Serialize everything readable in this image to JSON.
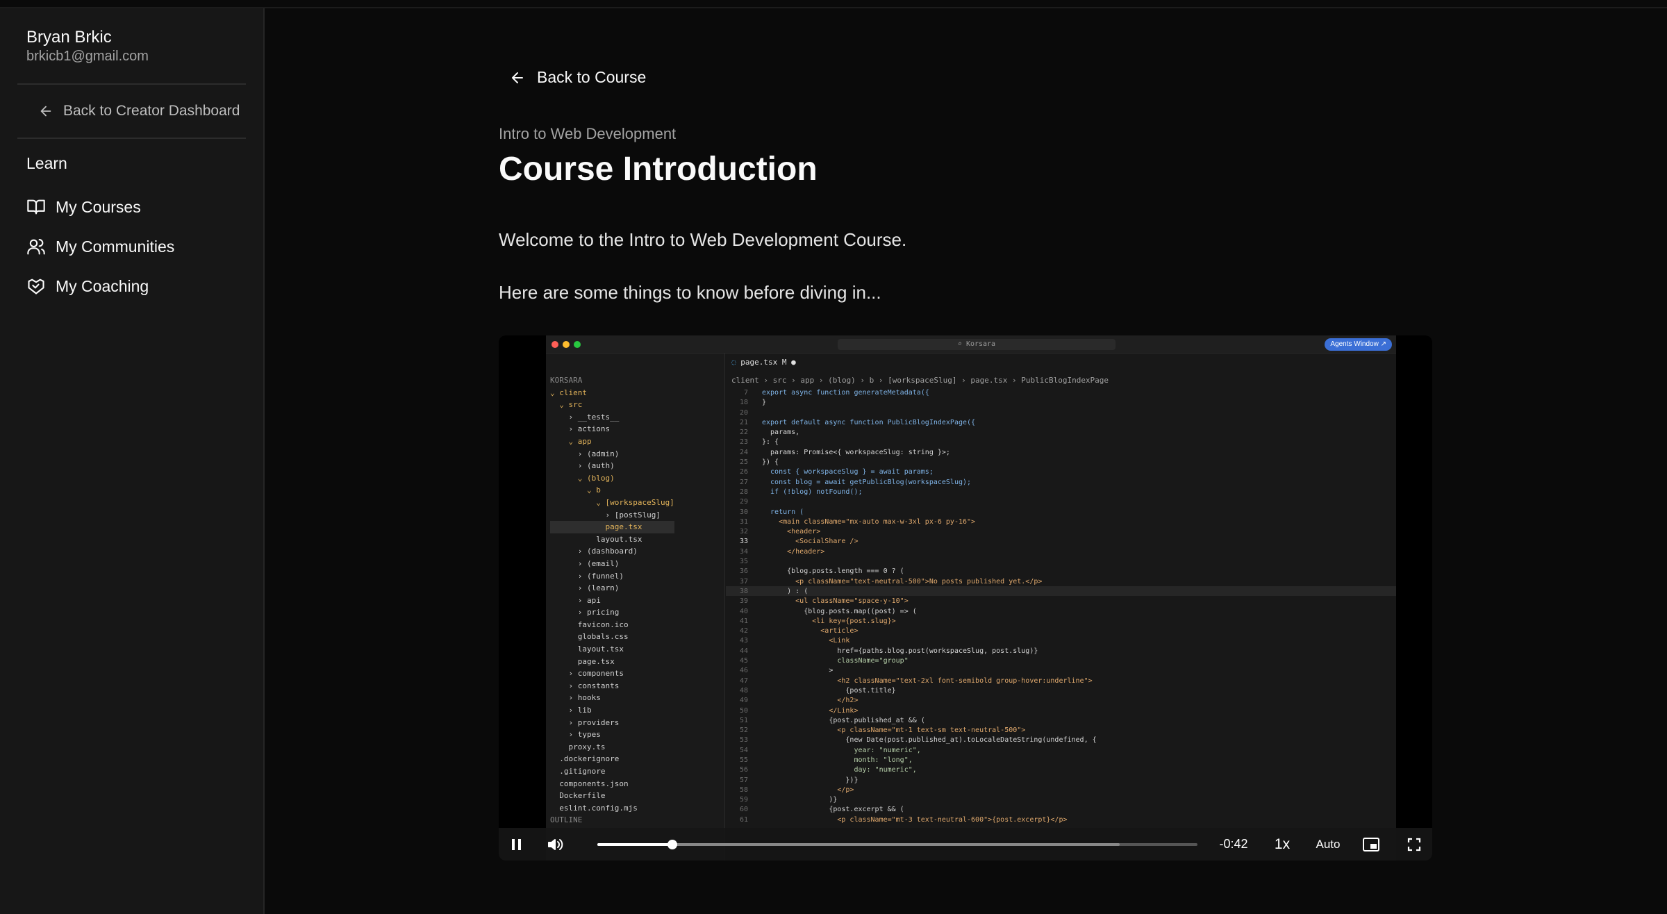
{
  "sidebar": {
    "user_name": "Bryan Brkic",
    "user_email": "brkicb1@gmail.com",
    "back_link": "Back to Creator Dashboard",
    "section_title": "Learn",
    "items": [
      {
        "label": "My Courses",
        "icon": "book-open-icon"
      },
      {
        "label": "My Communities",
        "icon": "users-icon"
      },
      {
        "label": "My Coaching",
        "icon": "handshake-icon"
      }
    ]
  },
  "main": {
    "back_link": "Back to Course",
    "course_name": "Intro to Web Development",
    "title": "Course Introduction",
    "paragraphs": [
      "Welcome to the Intro to Web Development Course.",
      "Here are some things to know before diving in..."
    ]
  },
  "video": {
    "time_remaining": "-0:42",
    "speed": "1x",
    "quality": "Auto",
    "progress": 0.125,
    "buffered": 0.87,
    "editor": {
      "search": "Korsara",
      "agents_button": "Agents Window ↗",
      "tab_label": "page.tsx  M",
      "breadcrumb": "client › src › app › (blog) › b › [workspaceSlug] › page.tsx › PublicBlogIndexPage",
      "tree": [
        "KORSARA",
        "⌄ client",
        "  ⌄ src",
        "    › __tests__",
        "    › actions",
        "    ⌄ app",
        "      › (admin)",
        "      › (auth)",
        "      ⌄ (blog)",
        "        ⌄ b",
        "          ⌄ [workspaceSlug]",
        "            › [postSlug]",
        "            page.tsx",
        "          layout.tsx",
        "      › (dashboard)",
        "      › (email)",
        "      › (funnel)",
        "      › (learn)",
        "      › api",
        "      › pricing",
        "      favicon.ico",
        "      globals.css",
        "      layout.tsx",
        "      page.tsx",
        "    › components",
        "    › constants",
        "    › hooks",
        "    › lib",
        "    › providers",
        "    › types",
        "    proxy.ts",
        "  .dockerignore",
        "  .gitignore",
        "  components.json",
        "  Dockerfile",
        "  eslint.config.mjs",
        "OUTLINE"
      ],
      "line_numbers": [
        "7",
        "18",
        "20",
        "21",
        "22",
        "23",
        "24",
        "25",
        "26",
        "27",
        "28",
        "29",
        "30",
        "31",
        "32",
        "33",
        "34",
        "35",
        "36",
        "37",
        "38",
        "39",
        "40",
        "41",
        "42",
        "43",
        "44",
        "45",
        "46",
        "47",
        "48",
        "49",
        "50",
        "51",
        "52",
        "53",
        "54",
        "55",
        "56",
        "57",
        "58",
        "59",
        "60",
        "61"
      ],
      "code": [
        "export async function generateMetadata({",
        "}",
        "",
        "export default async function PublicBlogIndexPage({",
        "  params,",
        "}: {",
        "  params: Promise<{ workspaceSlug: string }>;",
        "}) {",
        "  const { workspaceSlug } = await params;",
        "  const blog = await getPublicBlog(workspaceSlug);",
        "  if (!blog) notFound();",
        "",
        "  return (",
        "    <main className=\"mx-auto max-w-3xl px-6 py-16\">",
        "      <header>",
        "        <SocialShare />",
        "      </header>",
        "",
        "      {blog.posts.length === 0 ? (",
        "        <p className=\"text-neutral-500\">No posts published yet.</p>",
        "      ) : (",
        "        <ul className=\"space-y-10\">",
        "          {blog.posts.map((post) => (",
        "            <li key={post.slug}>",
        "              <article>",
        "                <Link",
        "                  href={paths.blog.post(workspaceSlug, post.slug)}",
        "                  className=\"group\"",
        "                >",
        "                  <h2 className=\"text-2xl font-semibold group-hover:underline\">",
        "                    {post.title}",
        "                  </h2>",
        "                </Link>",
        "                {post.published_at && (",
        "                  <p className=\"mt-1 text-sm text-neutral-500\">",
        "                    {new Date(post.published_at).toLocaleDateString(undefined, {",
        "                      year: \"numeric\",",
        "                      month: \"long\",",
        "                      day: \"numeric\",",
        "                    })}",
        "                  </p>",
        "                )}",
        "                {post.excerpt && (",
        "                  <p className=\"mt-3 text-neutral-600\">{post.excerpt}</p>"
      ]
    }
  },
  "colors": {
    "background": "#0a0a0a",
    "sidebar": "#171717",
    "text_primary": "#fafafa",
    "text_muted": "#a3a3a3"
  }
}
